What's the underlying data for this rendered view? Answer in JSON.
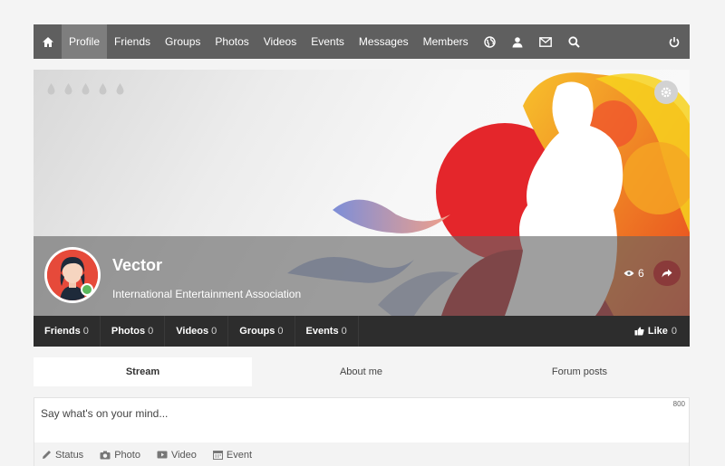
{
  "nav": {
    "items": [
      {
        "label": "Profile",
        "active": true
      },
      {
        "label": "Friends"
      },
      {
        "label": "Groups"
      },
      {
        "label": "Photos"
      },
      {
        "label": "Videos"
      },
      {
        "label": "Events"
      },
      {
        "label": "Messages"
      },
      {
        "label": "Members"
      }
    ],
    "icons": [
      "home-icon",
      "globe-icon",
      "friend-requests-icon",
      "mail-icon",
      "search-icon",
      "power-icon"
    ]
  },
  "profile": {
    "name": "Vector",
    "subtitle": "International Entertainment Association",
    "views": "6"
  },
  "stats": [
    {
      "label": "Friends",
      "count": "0"
    },
    {
      "label": "Photos",
      "count": "0"
    },
    {
      "label": "Videos",
      "count": "0"
    },
    {
      "label": "Groups",
      "count": "0"
    },
    {
      "label": "Events",
      "count": "0"
    }
  ],
  "like": {
    "label": "Like",
    "count": "0"
  },
  "tabs": [
    {
      "label": "Stream",
      "active": true
    },
    {
      "label": "About me"
    },
    {
      "label": "Forum posts"
    }
  ],
  "composer": {
    "placeholder": "Say what's on your mind...",
    "char_limit": "800",
    "tools": [
      {
        "label": "Status",
        "icon": "pencil-icon"
      },
      {
        "label": "Photo",
        "icon": "camera-icon"
      },
      {
        "label": "Video",
        "icon": "video-icon"
      },
      {
        "label": "Event",
        "icon": "calendar-icon"
      }
    ]
  },
  "colors": {
    "navbar": "#5f5f5f",
    "nav_active": "#7e7e7e",
    "statsbar": "#2d2d2d",
    "online": "#5cb85c",
    "avatar_bg": "#e64a3a"
  }
}
